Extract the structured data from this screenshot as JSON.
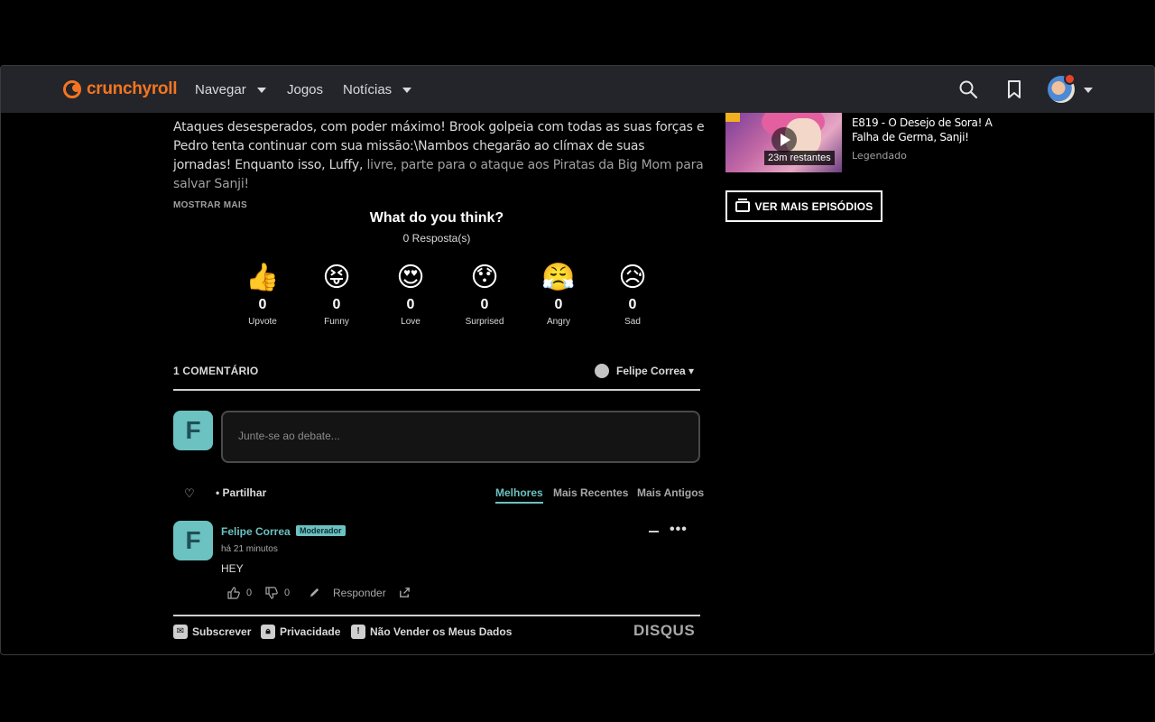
{
  "header": {
    "logo_text": "crunchyroll",
    "nav": [
      "Navegar",
      "Jogos",
      "Notícias"
    ],
    "icons": [
      "search-icon",
      "bookmark-icon",
      "user-avatar"
    ]
  },
  "episode": {
    "description_main": "Ataques desesperados, com poder máximo! Brook golpeia com todas as suas forças e Pedro tenta continuar com sua missão:\\Nambos chegarão ao clímax de suas jornadas! Enquanto isso, Luffy,",
    "description_fade": "livre, parte para o ataque aos Piratas da Big Mom para salvar Sanji!",
    "show_more": "MOSTRAR MAIS"
  },
  "reactions": {
    "title": "What do you think?",
    "responses": "0 Resposta(s)",
    "items": [
      {
        "emoji": "👍",
        "count": "0",
        "label": "Upvote"
      },
      {
        "emoji": "😝",
        "count": "0",
        "label": "Funny"
      },
      {
        "emoji": "😍",
        "count": "0",
        "label": "Love"
      },
      {
        "emoji": "😯",
        "count": "0",
        "label": "Surprised"
      },
      {
        "emoji": "😤",
        "count": "0",
        "label": "Angry"
      },
      {
        "emoji": "😥",
        "count": "0",
        "label": "Sad"
      }
    ]
  },
  "comments": {
    "count_label": "1 COMENTÁRIO",
    "user": "Felipe Correa ▾",
    "avatar_letter": "F",
    "placeholder": "Junte-se ao debate...",
    "share": "Partilhar",
    "sort": [
      "Melhores",
      "Mais Recentes",
      "Mais Antigos"
    ],
    "active_sort": "Melhores",
    "list": [
      {
        "author": "Felipe Correa",
        "badge": "Moderador",
        "time": "há 21 minutos",
        "text": "HEY",
        "upvotes": "0",
        "downvotes": "0",
        "reply": "Responder"
      }
    ],
    "footer": [
      "Subscrever",
      "Privacidade",
      "Não Vender os Meus Dados"
    ],
    "brand": "DISQUS"
  },
  "sidebar": {
    "episode_title": "E819 - O Desejo de Sora! A Falha de Germa, Sanji!",
    "episode_sub": "Legendado",
    "remaining": "23m restantes",
    "more_button": "VER MAIS EPISÓDIOS"
  },
  "colors": {
    "brand": "#f47521",
    "accent": "#6cc1c1",
    "header_bg": "#23252b"
  }
}
